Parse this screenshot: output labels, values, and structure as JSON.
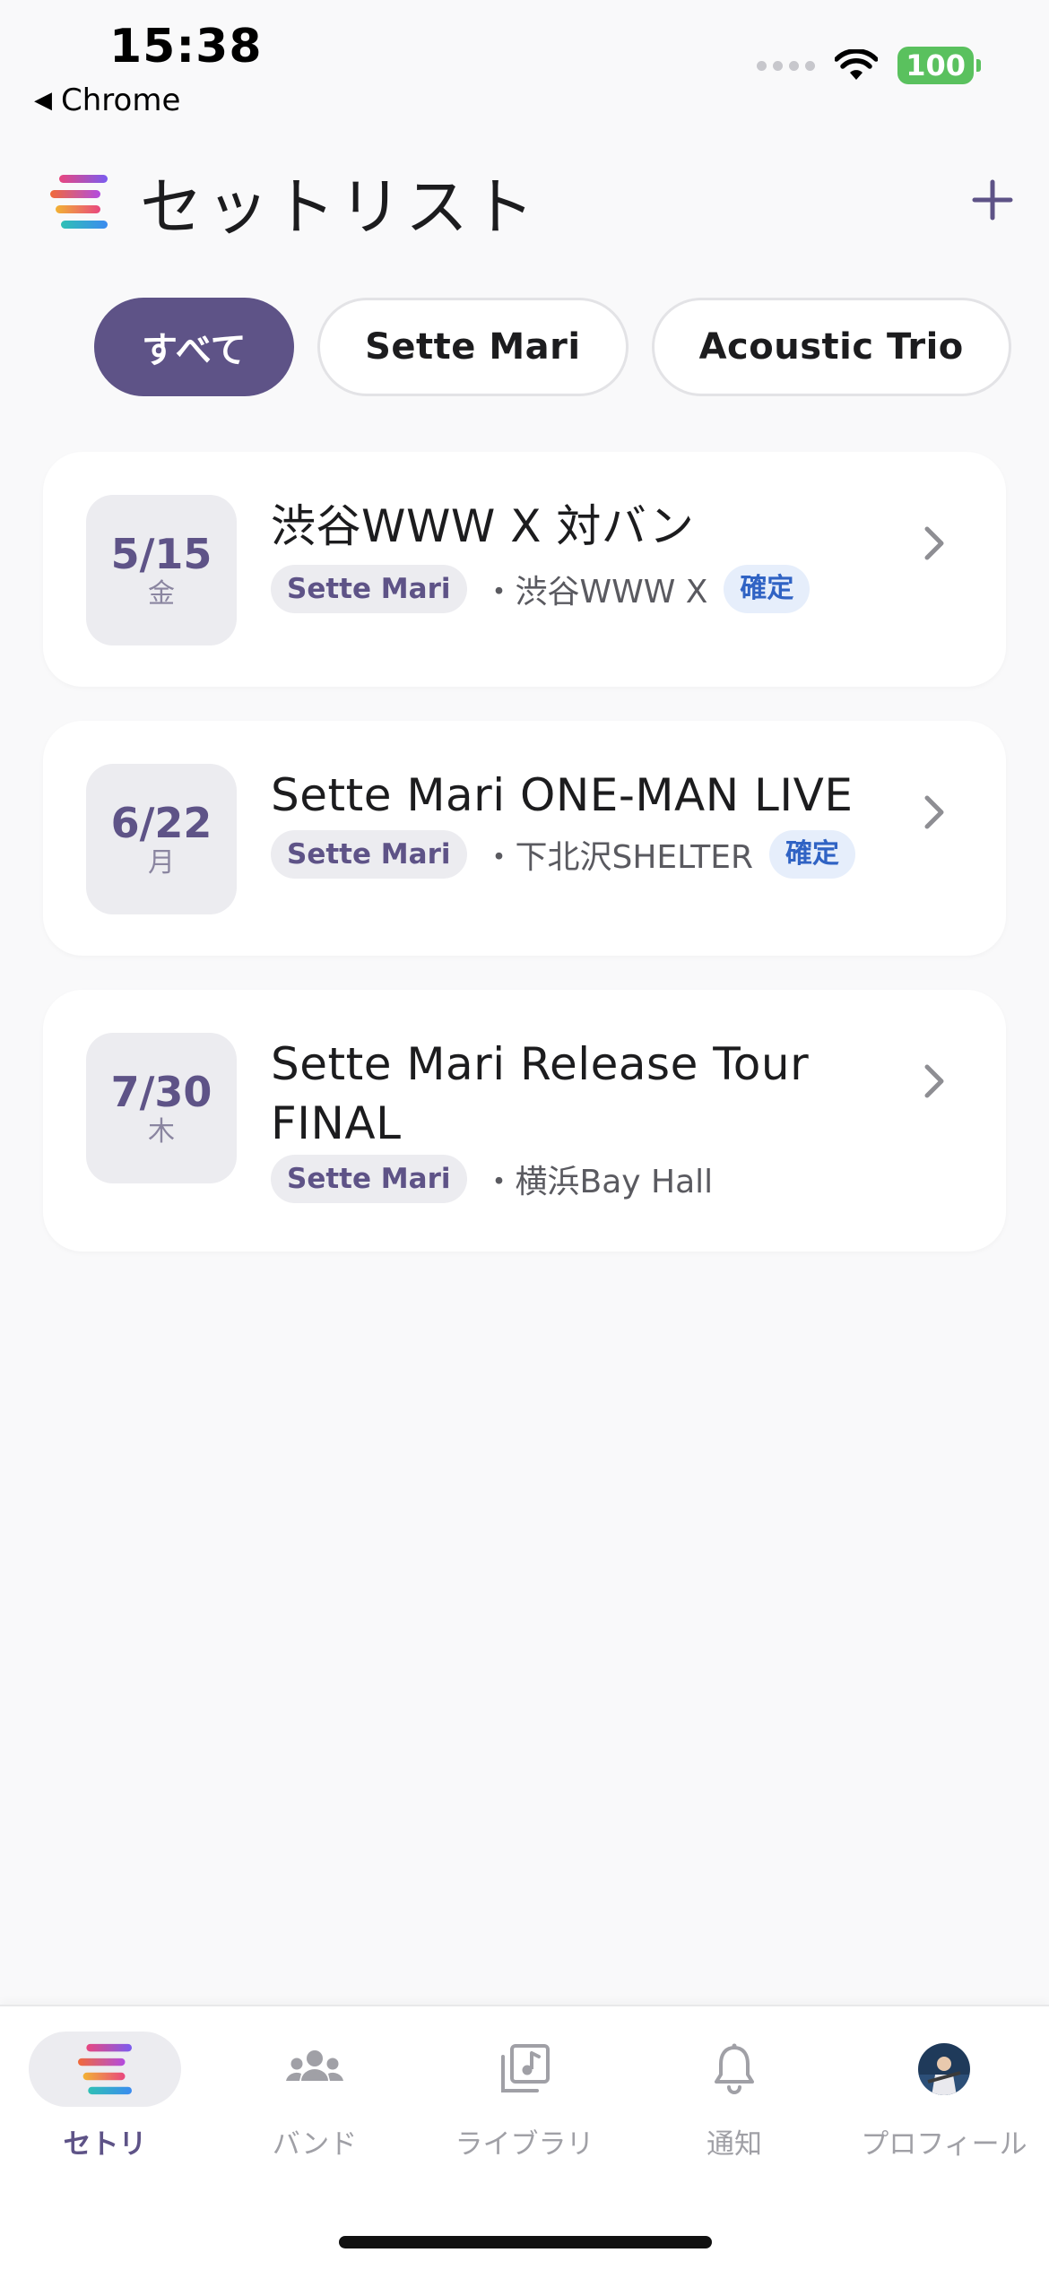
{
  "status_bar": {
    "time": "15:38",
    "back_app": "Chrome",
    "battery": "100"
  },
  "header": {
    "title": "セットリスト"
  },
  "filters": [
    {
      "label": "すべて",
      "active": true
    },
    {
      "label": "Sette Mari",
      "active": false
    },
    {
      "label": "Acoustic Trio",
      "active": false
    }
  ],
  "setlists": [
    {
      "date": "5/15",
      "weekday": "金",
      "title": "渋谷WWW X 対バン",
      "band": "Sette Mari",
      "venue": "・渋谷WWW X",
      "status": "確定"
    },
    {
      "date": "6/22",
      "weekday": "月",
      "title": "Sette Mari ONE-MAN LIVE",
      "band": "Sette Mari",
      "venue": "・下北沢SHELTER",
      "status": "確定"
    },
    {
      "date": "7/30",
      "weekday": "木",
      "title": "Sette Mari Release Tour FINAL",
      "band": "Sette Mari",
      "venue": "・横浜Bay Hall",
      "status": ""
    }
  ],
  "tabs": [
    {
      "label": "セトリ",
      "icon": "setlist-icon",
      "active": true
    },
    {
      "label": "バンド",
      "icon": "people-icon",
      "active": false
    },
    {
      "label": "ライブラリ",
      "icon": "music-library-icon",
      "active": false
    },
    {
      "label": "通知",
      "icon": "bell-icon",
      "active": false
    },
    {
      "label": "プロフィール",
      "icon": "avatar",
      "active": false
    }
  ],
  "colors": {
    "accent": "#5e5387",
    "confirmed": "#3063c4",
    "background": "#f9f9fa"
  }
}
